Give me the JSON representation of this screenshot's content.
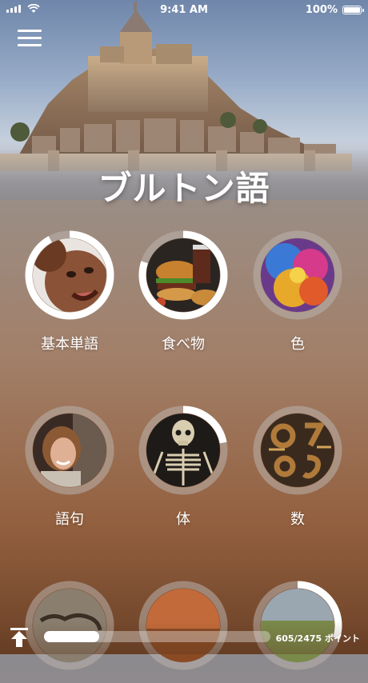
{
  "status_bar": {
    "time": "9:41 AM",
    "battery": "100%"
  },
  "header": {
    "title": "ブルトン語",
    "menu_icon": "hamburger-menu-icon"
  },
  "categories": [
    {
      "label": "基本単語",
      "progress": 0.92,
      "image": "baby-face"
    },
    {
      "label": "食べ物",
      "progress": 0.8,
      "image": "burger-meal"
    },
    {
      "label": "色",
      "progress": 0.0,
      "image": "color-powder"
    },
    {
      "label": "語句",
      "progress": 0.0,
      "image": "smiling-woman"
    },
    {
      "label": "体",
      "progress": 0.22,
      "image": "skeleton"
    },
    {
      "label": "数",
      "progress": 0.0,
      "image": "wooden-numbers"
    },
    {
      "label": "",
      "progress": 0.0,
      "image": "world-map"
    },
    {
      "label": "",
      "progress": 0.0,
      "image": "landscape"
    },
    {
      "label": "",
      "progress": 0.3,
      "image": "field"
    }
  ],
  "footer": {
    "upload_icon": "upload-arrow-icon",
    "progress_fraction": 0.244,
    "points_text": "605/2475 ポイント"
  },
  "colors": {
    "accent": "#ffffff",
    "track": "#b9b3ad"
  }
}
